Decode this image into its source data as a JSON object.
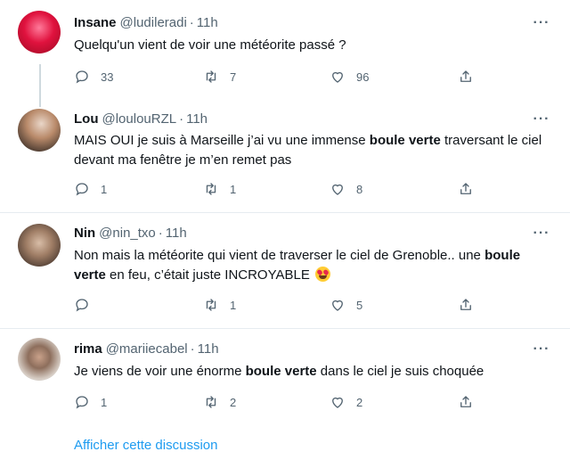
{
  "tweets": [
    {
      "name": "Insane",
      "handle": "@ludileradi",
      "dot": "·",
      "time": "11h",
      "more": "···",
      "text": "Quelqu'un vient de voir une météorite passé ?",
      "replies": "33",
      "retweets": "7",
      "likes": "96",
      "avatar_color": "#e0123e"
    },
    {
      "name": "Lou",
      "handle": "@loulouRZL",
      "dot": "·",
      "time": "11h",
      "more": "···",
      "text_parts": [
        "MAIS OUI je suis à Marseille j’ai vu une immense ",
        "boule verte",
        " traversant le ciel devant ma fenêtre je m’en remet pas"
      ],
      "replies": "1",
      "retweets": "1",
      "likes": "8"
    },
    {
      "name": "Nin",
      "handle": "@nin_txo",
      "dot": "·",
      "time": "11h",
      "more": "···",
      "text_parts": [
        "Non mais la météorite qui vient de traverser le ciel de Grenoble.. une ",
        "boule verte",
        " en feu, c’était juste INCROYABLE"
      ],
      "emoji": "heart-eyes-emoji",
      "replies": "",
      "retweets": "1",
      "likes": "5"
    },
    {
      "name": "rima",
      "handle": "@mariiecabel",
      "dot": "·",
      "time": "11h",
      "more": "···",
      "text_parts": [
        "Je viens de voir une énorme ",
        "boule verte",
        " dans le ciel je suis choquée"
      ],
      "replies": "1",
      "retweets": "2",
      "likes": "2"
    }
  ],
  "show_thread": "Afficher cette discussion",
  "colors": {
    "link": "#1d9bf0",
    "muted": "#536471",
    "text": "#0f1419",
    "divider": "#e6ecf0"
  }
}
